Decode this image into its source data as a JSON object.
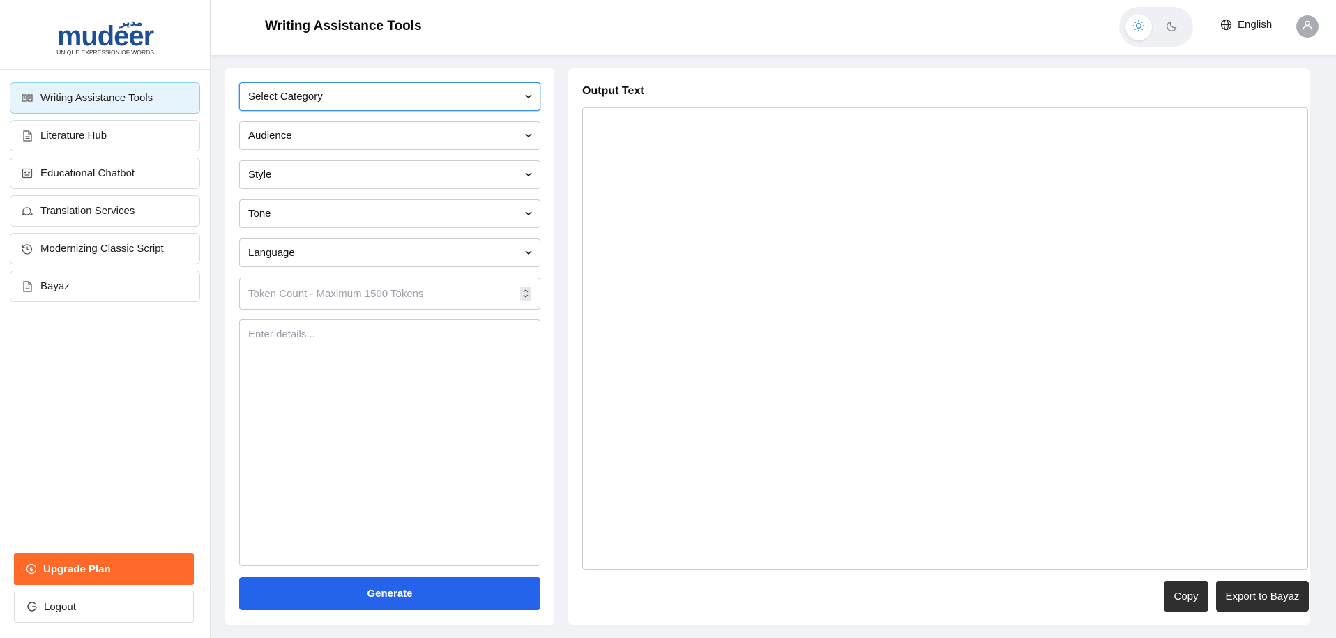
{
  "brand": {
    "arabic": "مدير",
    "name": "mudeer",
    "tagline": "UNIQUE EXPRESSION OF WORDS",
    "color": "#1c4f95"
  },
  "sidebar": {
    "items": [
      {
        "label": "Writing Assistance Tools",
        "icon": "book-open-icon",
        "active": true
      },
      {
        "label": "Literature Hub",
        "icon": "document-icon",
        "active": false
      },
      {
        "label": "Educational Chatbot",
        "icon": "chatbot-icon",
        "active": false
      },
      {
        "label": "Translation Services",
        "icon": "chat-bubbles-icon",
        "active": false
      },
      {
        "label": "Modernizing Classic Script",
        "icon": "history-clock-icon",
        "active": false
      },
      {
        "label": "Bayaz",
        "icon": "file-text-icon",
        "active": false
      }
    ],
    "upgrade_label": "Upgrade Plan",
    "logout_label": "Logout"
  },
  "header": {
    "title": "Writing Assistance Tools",
    "language": "English",
    "theme": "light"
  },
  "form": {
    "category": "Select Category",
    "audience": "Audience",
    "style": "Style",
    "tone": "Tone",
    "language": "Language",
    "token_placeholder": "Token Count - Maximum 1500 Tokens",
    "details_placeholder": "Enter details...",
    "generate_label": "Generate"
  },
  "output": {
    "title": "Output Text",
    "copy_label": "Copy",
    "export_label": "Export to Bayaz"
  },
  "colors": {
    "accent_orange": "#ff6a2b",
    "primary_blue": "#2563eb",
    "dark_button": "#2f2f2f",
    "active_nav_bg": "#e6f4fd"
  }
}
